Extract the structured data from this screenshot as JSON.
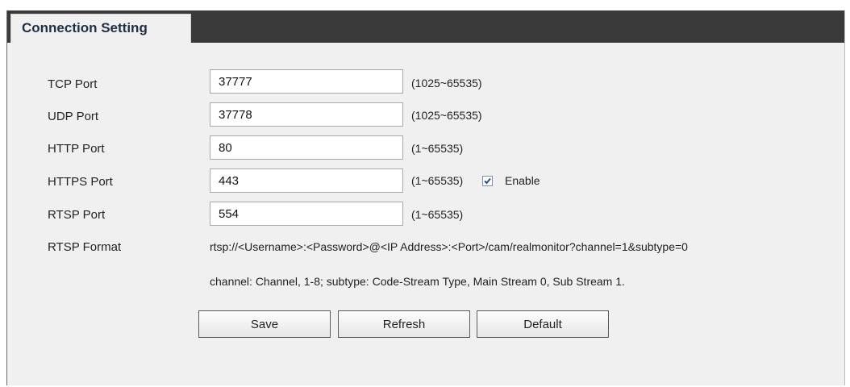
{
  "tab": {
    "title": "Connection Setting"
  },
  "ports": [
    {
      "label": "TCP Port",
      "value": "37777",
      "range": "(1025~65535)"
    },
    {
      "label": "UDP Port",
      "value": "37778",
      "range": "(1025~65535)"
    },
    {
      "label": "HTTP Port",
      "value": "80",
      "range": "(1~65535)"
    },
    {
      "label": "HTTPS Port",
      "value": "443",
      "range": "(1~65535)"
    },
    {
      "label": "RTSP Port",
      "value": "554",
      "range": "(1~65535)"
    }
  ],
  "https": {
    "enable_label": "Enable",
    "enabled": true
  },
  "rtsp_format": {
    "label": "RTSP Format",
    "url": "rtsp://<Username>:<Password>@<IP Address>:<Port>/cam/realmonitor?channel=1&subtype=0",
    "note": "channel: Channel, 1-8; subtype: Code-Stream Type, Main Stream 0, Sub Stream 1."
  },
  "buttons": {
    "save": "Save",
    "refresh": "Refresh",
    "default": "Default"
  },
  "colors": {
    "header": "#3a3a3a",
    "panel": "#f0f0f0",
    "tab_text": "#1f2f44",
    "check": "#2a4f8f"
  },
  "icons": {
    "enable_checkbox": "checkmark-icon"
  }
}
